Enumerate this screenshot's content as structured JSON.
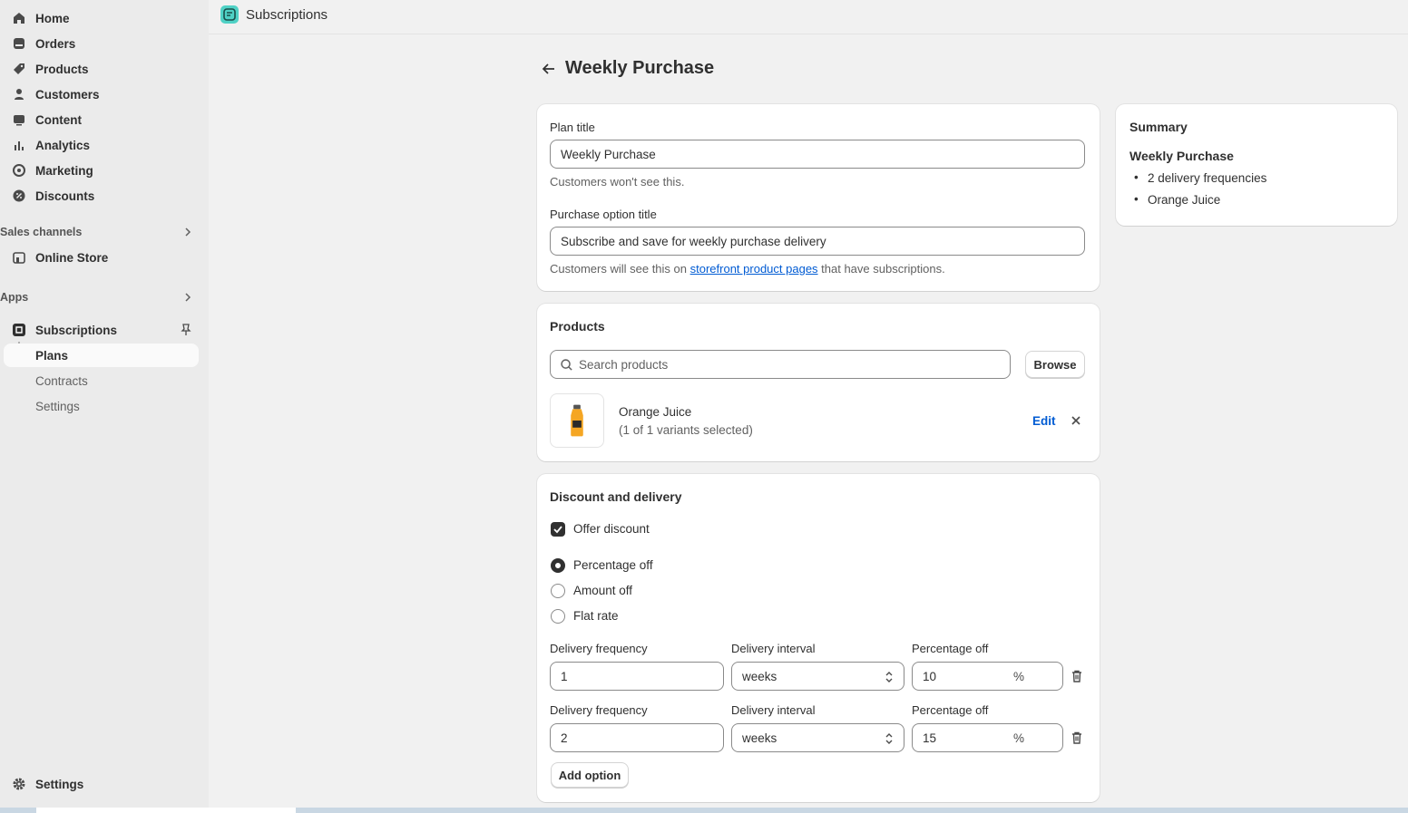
{
  "sidebar": {
    "items": [
      {
        "label": "Home",
        "icon": "home-icon"
      },
      {
        "label": "Orders",
        "icon": "orders-icon"
      },
      {
        "label": "Products",
        "icon": "tag-icon"
      },
      {
        "label": "Customers",
        "icon": "person-icon"
      },
      {
        "label": "Content",
        "icon": "content-icon"
      },
      {
        "label": "Analytics",
        "icon": "bar-chart-icon"
      },
      {
        "label": "Marketing",
        "icon": "target-icon"
      },
      {
        "label": "Discounts",
        "icon": "discount-icon"
      }
    ],
    "sales_channels_label": "Sales channels",
    "online_store_label": "Online Store",
    "apps_label": "Apps",
    "app_name": "Subscriptions",
    "app_subitems": [
      "Plans",
      "Contracts",
      "Settings"
    ],
    "settings_label": "Settings"
  },
  "topbar": {
    "app_title": "Subscriptions"
  },
  "page": {
    "title": "Weekly Purchase"
  },
  "plan_card": {
    "plan_title_label": "Plan title",
    "plan_title_value": "Weekly Purchase",
    "plan_title_help": "Customers won't see this.",
    "purchase_option_label": "Purchase option title",
    "purchase_option_value": "Subscribe and save for weekly purchase delivery",
    "help_prefix": "Customers will see this on ",
    "help_link": "storefront product pages",
    "help_suffix": " that have subscriptions."
  },
  "products_card": {
    "title": "Products",
    "search_placeholder": "Search products",
    "browse_label": "Browse",
    "product_name": "Orange Juice",
    "product_variants": "(1 of 1 variants selected)",
    "edit_label": "Edit"
  },
  "discount_card": {
    "title": "Discount and delivery",
    "offer_discount_label": "Offer discount",
    "offer_discount_checked": true,
    "discount_types": [
      "Percentage off",
      "Amount off",
      "Flat rate"
    ],
    "selected_type": "Percentage off",
    "rows": [
      {
        "freq_label": "Delivery frequency",
        "freq_value": "1",
        "interval_label": "Delivery interval",
        "interval_value": "weeks",
        "pct_label": "Percentage off",
        "pct_value": "10",
        "suffix": "%"
      },
      {
        "freq_label": "Delivery frequency",
        "freq_value": "2",
        "interval_label": "Delivery interval",
        "interval_value": "weeks",
        "pct_label": "Percentage off",
        "pct_value": "15",
        "suffix": "%"
      }
    ],
    "add_option_label": "Add option"
  },
  "summary_card": {
    "title": "Summary",
    "plan_name": "Weekly Purchase",
    "bullets": [
      "2 delivery frequencies",
      "Orange Juice"
    ]
  }
}
